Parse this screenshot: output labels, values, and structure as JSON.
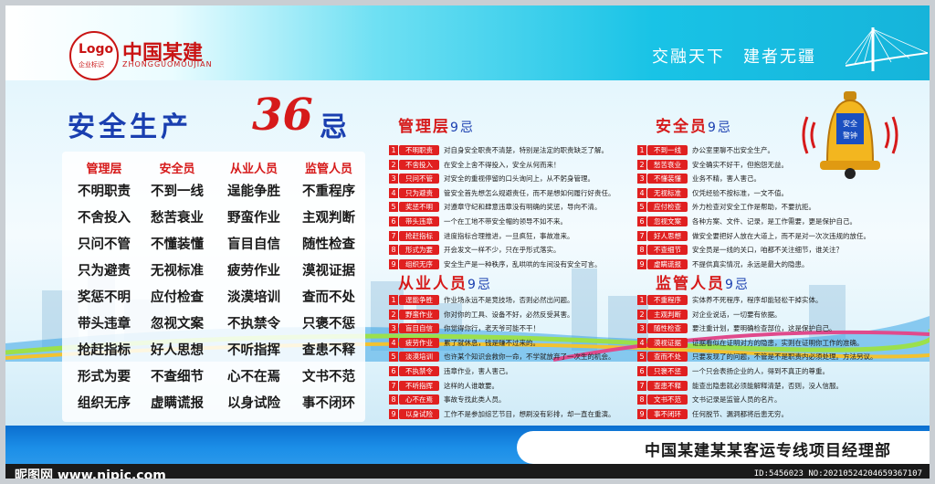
{
  "header": {
    "logo_text": "Logo",
    "logo_sub": "企业标识",
    "company_name": "中国某建",
    "company_en": "ZHONGGUOMOUJIAN",
    "slogan": "交融天下　建者无疆"
  },
  "title": {
    "prefix": "安全生产",
    "number": "36",
    "suffix": "忌"
  },
  "bell": {
    "label_line1": "安全",
    "label_line2": "警钟"
  },
  "grid": {
    "headers": [
      "管理层",
      "安全员",
      "从业人员",
      "监管人员"
    ],
    "columns": [
      [
        "不明职责",
        "不舍投入",
        "只问不管",
        "只为避责",
        "奖惩不明",
        "带头违章",
        "抢赶指标",
        "形式为要",
        "组织无序"
      ],
      [
        "不到一线",
        "愁苦衰业",
        "不懂装懂",
        "无视标准",
        "应付检查",
        "忽视文案",
        "好人思想",
        "不查细节",
        "虚瞒谎报"
      ],
      [
        "逞能争胜",
        "野蛮作业",
        "盲目自信",
        "疲劳作业",
        "淡漠培训",
        "不执禁令",
        "不听指挥",
        "心不在焉",
        "以身试险"
      ],
      [
        "不重程序",
        "主观判断",
        "随性检查",
        "漠视证据",
        "查而不处",
        "只褒不惩",
        "查患不释",
        "文书不范",
        "事不闭环"
      ]
    ]
  },
  "sections": {
    "management": {
      "title": "管理层",
      "count": "9忌",
      "items": [
        {
          "n": "1",
          "tag": "不明职责",
          "desc": "对自身安全职责不清楚，特别是法定的职责缺乏了解。"
        },
        {
          "n": "2",
          "tag": "不舍投入",
          "desc": "在安全上舍不得投入，安全从何而来！"
        },
        {
          "n": "3",
          "tag": "只问不管",
          "desc": "对安全的重视停留的口头询问上，从不躬身管理。"
        },
        {
          "n": "4",
          "tag": "只为避责",
          "desc": "管安全首先想怎么规避责任，而不是想如何履行好责任。"
        },
        {
          "n": "5",
          "tag": "奖惩不明",
          "desc": "对遵章守纪和肆意违章没有明确的奖惩，导向不清。"
        },
        {
          "n": "6",
          "tag": "带头违章",
          "desc": "一个在工地不带安全帽的领导不如不来。"
        },
        {
          "n": "7",
          "tag": "抢赶指标",
          "desc": "进度指标合理推进，一旦疯狂，事故准来。"
        },
        {
          "n": "8",
          "tag": "形式为要",
          "desc": "开会发文一样不少，只在乎形式落实。"
        },
        {
          "n": "9",
          "tag": "组织无序",
          "desc": "安全生产是一种秩序，乱哄哄的车间没有安全可言。"
        }
      ]
    },
    "safety_officer": {
      "title": "安全员",
      "count": "9忌",
      "items": [
        {
          "n": "1",
          "tag": "不到一线",
          "desc": "办公室里聊不出安全生产。"
        },
        {
          "n": "2",
          "tag": "愁苦衰业",
          "desc": "安全确实不好干，但抱怨无益。"
        },
        {
          "n": "3",
          "tag": "不懂装懂",
          "desc": "业务不精，害人害己。"
        },
        {
          "n": "4",
          "tag": "无视标准",
          "desc": "仅凭经验不按标准，一文不值。"
        },
        {
          "n": "5",
          "tag": "应付检查",
          "desc": "外力检查对安全工作是帮助，不要抗拒。"
        },
        {
          "n": "6",
          "tag": "忽视文案",
          "desc": "各种方案、文件、记录，是工作需要，更是保护自己。"
        },
        {
          "n": "7",
          "tag": "好人思想",
          "desc": "做安全要把好人放在大道上，而不是对一次次违规的放任。"
        },
        {
          "n": "8",
          "tag": "不查细节",
          "desc": "安全员是一线的关口，咱都不关注细节，谁关注？"
        },
        {
          "n": "9",
          "tag": "虚瞒谎报",
          "desc": "不提供真实情况，永远是最大的隐患。"
        }
      ]
    },
    "workers": {
      "title": "从业人员",
      "count": "9忌",
      "items": [
        {
          "n": "1",
          "tag": "逞能争胜",
          "desc": "作业场永远不是竞技场，否则必然出问题。"
        },
        {
          "n": "2",
          "tag": "野蛮作业",
          "desc": "你对你的工具、设备不好，必然反受其害。"
        },
        {
          "n": "3",
          "tag": "盲目自信",
          "desc": "你觉得你行，老天爷可能不干！"
        },
        {
          "n": "4",
          "tag": "疲劳作业",
          "desc": "累了就休息，钱是赚不过来的。"
        },
        {
          "n": "5",
          "tag": "淡漠培训",
          "desc": "也许某个知识会救你一命，不学就放弃了一次生的机会。"
        },
        {
          "n": "6",
          "tag": "不执禁令",
          "desc": "违章作业，害人害己。"
        },
        {
          "n": "7",
          "tag": "不听指挥",
          "desc": "这样的人谁敢要。"
        },
        {
          "n": "8",
          "tag": "心不在焉",
          "desc": "事故专找此类人员。"
        },
        {
          "n": "9",
          "tag": "以身试险",
          "desc": "工作不是参加综艺节目，想刷没有彩排，却一直在重演。"
        }
      ]
    },
    "supervisors": {
      "title": "监管人员",
      "count": "9忌",
      "items": [
        {
          "n": "1",
          "tag": "不重程序",
          "desc": "实体养不死程序，程序却能轻松干掉实体。"
        },
        {
          "n": "2",
          "tag": "主观判断",
          "desc": "对企业说话，一切要有依据。"
        },
        {
          "n": "3",
          "tag": "随性检查",
          "desc": "要注重计划，要明确检查部位，这是保护自己。"
        },
        {
          "n": "4",
          "tag": "漠视证据",
          "desc": "证据看似在证明对方的隐患，实则在证明你工作的准确。"
        },
        {
          "n": "5",
          "tag": "查而不处",
          "desc": "只要发现了的问题，不管是不是职责内必须处理。方法另议。"
        },
        {
          "n": "6",
          "tag": "只褒不惩",
          "desc": "一个只会表扬企业的人，得到不真正的尊重。"
        },
        {
          "n": "7",
          "tag": "查患不释",
          "desc": "能查出隐患就必须能解释清楚，否则，没人信服。"
        },
        {
          "n": "8",
          "tag": "文书不范",
          "desc": "文书记录是监管人员的名片。"
        },
        {
          "n": "9",
          "tag": "事不闭环",
          "desc": "任何脱节、漏洞都将后患无穷。"
        }
      ]
    }
  },
  "footer": {
    "department": "中国某建某某客运专线项目经理部"
  },
  "watermark": {
    "site": "昵图网 www.nipic.com",
    "id_line": "ID:5456023 NO:20210524204659367107"
  }
}
